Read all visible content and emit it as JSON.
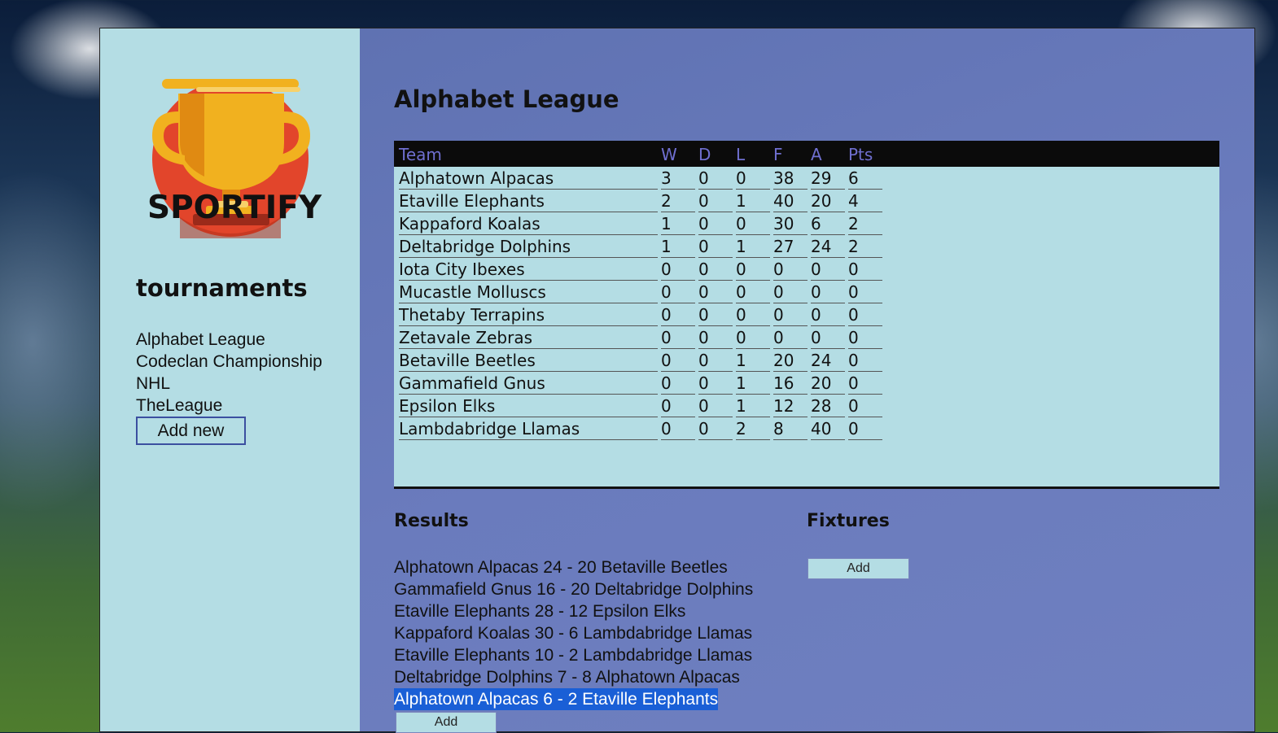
{
  "brand": {
    "logo_text": "SPORTIFY",
    "icon": "trophy-icon",
    "colors": {
      "circle": "#e2452b",
      "trophy": "#f1b11f",
      "trophy_dark": "#e08a12"
    }
  },
  "sidebar": {
    "title": "tournaments",
    "tournaments": [
      "Alphabet League",
      "Codeclan Championship",
      "NHL",
      "TheLeague"
    ],
    "add_new_label": "Add new"
  },
  "league": {
    "title": "Alphabet League",
    "columns": [
      "Team",
      "W",
      "D",
      "L",
      "F",
      "A",
      "Pts"
    ],
    "rows": [
      {
        "team": "Alphatown Alpacas",
        "w": "3",
        "d": "0",
        "l": "0",
        "f": "38",
        "a": "29",
        "pts": "6"
      },
      {
        "team": "Etaville Elephants",
        "w": "2",
        "d": "0",
        "l": "1",
        "f": "40",
        "a": "20",
        "pts": "4"
      },
      {
        "team": "Kappaford Koalas",
        "w": "1",
        "d": "0",
        "l": "0",
        "f": "30",
        "a": "6",
        "pts": "2"
      },
      {
        "team": "Deltabridge Dolphins",
        "w": "1",
        "d": "0",
        "l": "1",
        "f": "27",
        "a": "24",
        "pts": "2"
      },
      {
        "team": "Iota City Ibexes",
        "w": "0",
        "d": "0",
        "l": "0",
        "f": "0",
        "a": "0",
        "pts": "0"
      },
      {
        "team": "Mucastle Molluscs",
        "w": "0",
        "d": "0",
        "l": "0",
        "f": "0",
        "a": "0",
        "pts": "0"
      },
      {
        "team": "Thetaby Terrapins",
        "w": "0",
        "d": "0",
        "l": "0",
        "f": "0",
        "a": "0",
        "pts": "0"
      },
      {
        "team": "Zetavale Zebras",
        "w": "0",
        "d": "0",
        "l": "0",
        "f": "0",
        "a": "0",
        "pts": "0"
      },
      {
        "team": "Betaville Beetles",
        "w": "0",
        "d": "0",
        "l": "1",
        "f": "20",
        "a": "24",
        "pts": "0"
      },
      {
        "team": "Gammafield Gnus",
        "w": "0",
        "d": "0",
        "l": "1",
        "f": "16",
        "a": "20",
        "pts": "0"
      },
      {
        "team": "Epsilon Elks",
        "w": "0",
        "d": "0",
        "l": "1",
        "f": "12",
        "a": "28",
        "pts": "0"
      },
      {
        "team": "Lambdabridge Llamas",
        "w": "0",
        "d": "0",
        "l": "2",
        "f": "8",
        "a": "40",
        "pts": "0"
      }
    ]
  },
  "results": {
    "title": "Results",
    "items": [
      "Alphatown Alpacas 24 - 20 Betaville Beetles",
      "Gammafield Gnus 16 - 20 Deltabridge Dolphins",
      "Etaville Elephants 28 - 12 Epsilon Elks",
      "Kappaford Koalas 30 - 6 Lambdabridge Llamas",
      "Etaville Elephants 10 - 2 Lambdabridge Llamas",
      "Deltabridge Dolphins 7 - 8 Alphatown Alpacas",
      "Alphatown Alpacas 6 - 2 Etaville Elephants"
    ],
    "selected_index": 6,
    "add_label": "Add"
  },
  "fixtures": {
    "title": "Fixtures",
    "add_label": "Add"
  }
}
